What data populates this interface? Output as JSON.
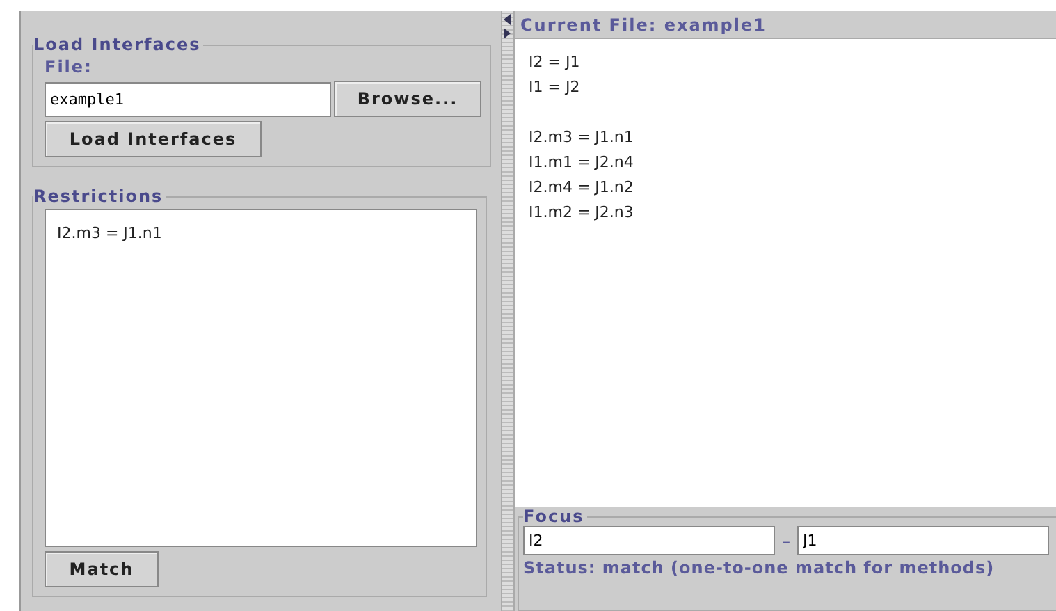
{
  "load_group": {
    "title": "Load Interfaces",
    "file_label": "File:",
    "file_value": "example1",
    "browse_button": "Browse...",
    "load_button": "Load Interfaces"
  },
  "restrictions": {
    "title": "Restrictions",
    "lines": [
      "I2.m3 = J1.n1"
    ],
    "match_button": "Match"
  },
  "current_file": {
    "title": "Current File: example1",
    "interface_lines": [
      "I2 = J1",
      "I1 = J2"
    ],
    "method_lines": [
      "I2.m3 = J1.n1",
      "I1.m1 = J2.n4",
      "I2.m4 = J1.n2",
      "I1.m2 = J2.n3"
    ]
  },
  "focus": {
    "title": "Focus",
    "left_value": "I2",
    "separator": "–",
    "right_value": "J1",
    "status": "Status: match (one-to-one match for methods)"
  }
}
